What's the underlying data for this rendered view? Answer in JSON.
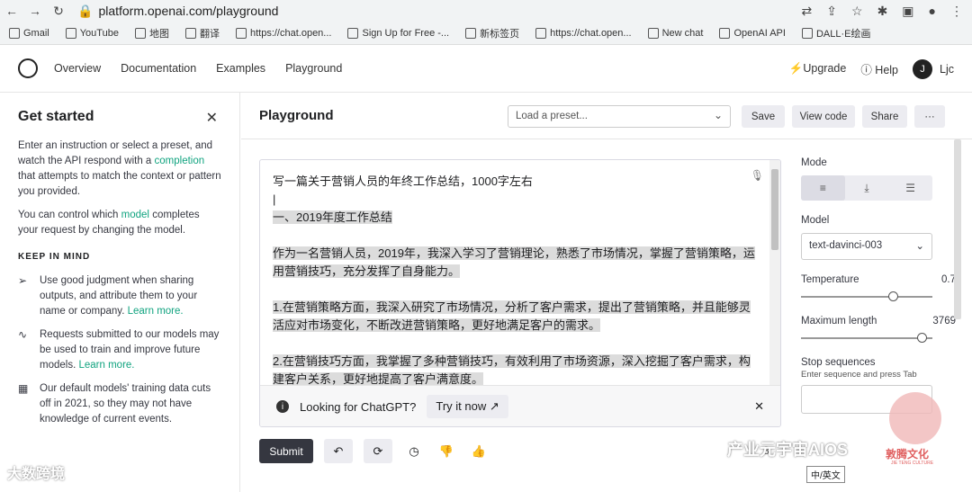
{
  "browser": {
    "url": "platform.openai.com/playground"
  },
  "bookmarks": [
    "Gmail",
    "YouTube",
    "地图",
    "翻译",
    "https://chat.open...",
    "Sign Up for Free -...",
    "新标签页",
    "https://chat.open...",
    "New chat",
    "OpenAI API",
    "DALL·E绘画"
  ],
  "appbar": {
    "nav": [
      "Overview",
      "Documentation",
      "Examples",
      "Playground"
    ],
    "upgrade": "Upgrade",
    "help": "Help",
    "user_initial": "J",
    "user_name": "Ljc"
  },
  "sidebar": {
    "title": "Get started",
    "intro_a": "Enter an instruction or select a preset, and watch the API respond with a",
    "intro_link": "completion",
    "intro_b": "that attempts to match the context or pattern you provided.",
    "model_a": "You can control which",
    "model_link": "model",
    "model_b": "completes your request by changing the model.",
    "keep": "KEEP IN MIND",
    "tip1": "Use good judgment when sharing outputs, and attribute them to your name or company.",
    "tip1_link": "Learn more.",
    "tip2": "Requests submitted to our models may be used to train and improve future models.",
    "tip2_link": "Learn more.",
    "tip3": "Our default models' training data cuts off in 2021, so they may not have knowledge of current events."
  },
  "header": {
    "title": "Playground",
    "preset_placeholder": "Load a preset...",
    "save": "Save",
    "view_code": "View code",
    "share": "Share",
    "more": "···"
  },
  "editor": {
    "prompt": "写一篇关于营销人员的年终工作总结，1000字左右",
    "h1": "一、2019年度工作总结",
    "p1": "作为一名营销人员，2019年，我深入学习了营销理论，熟悉了市场情况，掌握了营销策略，运用营销技巧，充分发挥了自身能力。",
    "p2": "1.在营销策略方面，我深入研究了市场情况，分析了客户需求，提出了营销策略，并且能够灵活应对市场变化，不断改进营销策略，更好地满足客户的需求。",
    "p3": "2.在营销技巧方面，我掌握了多种营销技巧，有效利用了市场资源，深入挖掘了客户需求，构建客户关系，更好地提高了客户满意度。"
  },
  "banner": {
    "text": "Looking for ChatGPT?",
    "try": "Try it now"
  },
  "bottom": {
    "submit": "Submit",
    "count": "8"
  },
  "settings": {
    "mode": "Mode",
    "model_label": "Model",
    "model": "text-davinci-003",
    "temperature_label": "Temperature",
    "temperature": "0.7",
    "temperature_frac": 0.7,
    "maxlen_label": "Maximum length",
    "maxlen": "3769",
    "maxlen_frac": 0.92,
    "stop_label": "Stop sequences",
    "stop_hint": "Enter sequence and press Tab"
  },
  "ime": "中/英文",
  "watermarks": {
    "left": "大数跨境",
    "right": "产业元宇宙AIOS",
    "seal": "敦腾文化",
    "seal_sub": "JIE TENG CULTURE"
  }
}
